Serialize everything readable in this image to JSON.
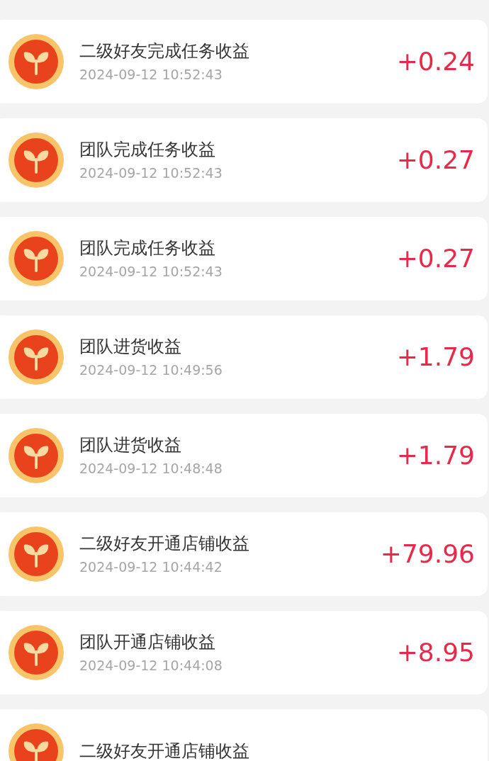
{
  "records": [
    {
      "title": "二级好友完成任务收益",
      "time": "2024-09-12 10:52:43",
      "amount": "+0.24"
    },
    {
      "title": "团队完成任务收益",
      "time": "2024-09-12 10:52:43",
      "amount": "+0.27"
    },
    {
      "title": "团队完成任务收益",
      "time": "2024-09-12 10:52:43",
      "amount": "+0.27"
    },
    {
      "title": "团队进货收益",
      "time": "2024-09-12 10:49:56",
      "amount": "+1.79"
    },
    {
      "title": "团队进货收益",
      "time": "2024-09-12 10:48:48",
      "amount": "+1.79"
    },
    {
      "title": "二级好友开通店铺收益",
      "time": "2024-09-12 10:44:42",
      "amount": "+79.96"
    },
    {
      "title": "团队开通店铺收益",
      "time": "2024-09-12 10:44:08",
      "amount": "+8.95"
    },
    {
      "title": "二级好友开通店铺收益"
    }
  ]
}
